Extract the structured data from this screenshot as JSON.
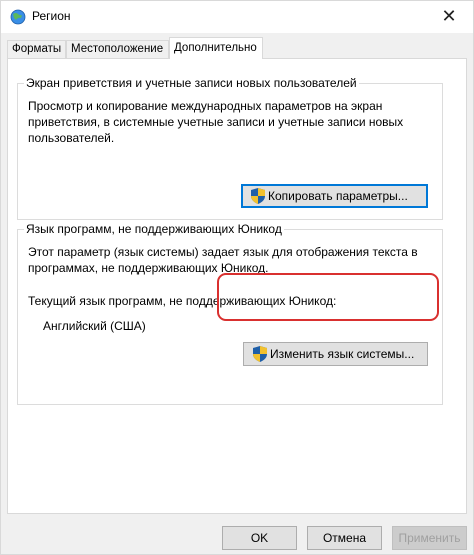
{
  "window": {
    "title": "Регион",
    "icon": "globe-icon",
    "close_glyph": "✕"
  },
  "tabs": [
    {
      "label": "Форматы",
      "active": false
    },
    {
      "label": "Местоположение",
      "active": false
    },
    {
      "label": "Дополнительно",
      "active": true
    }
  ],
  "welcome_group": {
    "legend": "Экран приветствия и учетные записи новых пользователей",
    "description": "Просмотр и копирование международных параметров на экран приветствия, в системные учетные записи и учетные записи новых пользователей.",
    "button_label": "Копировать параметры..."
  },
  "unicode_group": {
    "legend": "Язык программ, не поддерживающих Юникод",
    "description": "Этот параметр (язык системы) задает язык для отображения текста в программах, не поддерживающих Юникод.",
    "current_label": "Текущий язык программ, не поддерживающих Юникод:",
    "current_value": "Английский (США)",
    "button_label": "Изменить язык системы..."
  },
  "footer": {
    "ok_label": "OK",
    "cancel_label": "Отмена",
    "apply_label": "Применить"
  },
  "colors": {
    "highlight": "#d9302f",
    "default_button_border": "#0078d7"
  }
}
